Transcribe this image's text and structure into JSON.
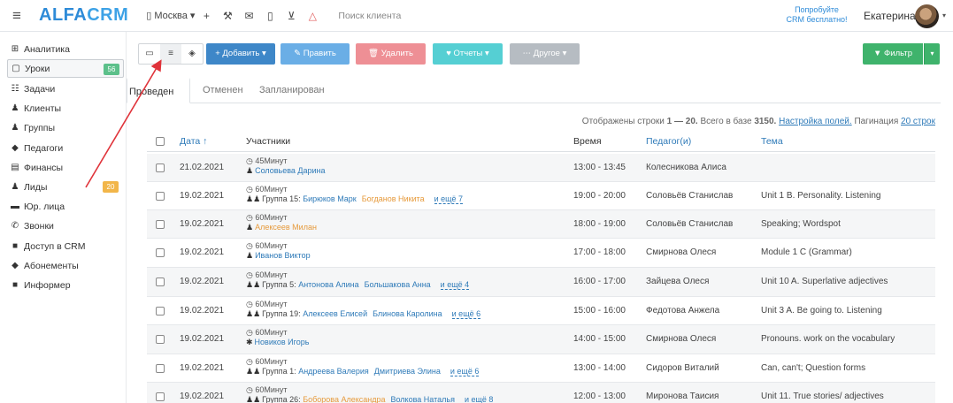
{
  "header": {
    "logo_part1": "ALFA",
    "logo_part2": "CRM",
    "city": "Москва",
    "search_placeholder": "Поиск клиента",
    "try_line1": "Попробуйте",
    "try_line2": "CRM бесплатно!",
    "user_name": "Екатерина"
  },
  "sidebar": {
    "items": [
      {
        "label": "Аналитика",
        "icon": "chart-icon"
      },
      {
        "label": "Уроки",
        "icon": "calendar-icon",
        "badge": "56"
      },
      {
        "label": "Задачи",
        "icon": "tasks-icon"
      },
      {
        "label": "Клиенты",
        "icon": "user-icon"
      },
      {
        "label": "Группы",
        "icon": "users-icon"
      },
      {
        "label": "Педагоги",
        "icon": "graduation-cap-icon"
      },
      {
        "label": "Финансы",
        "icon": "money-icon"
      },
      {
        "label": "Лиды",
        "icon": "user-plus-icon",
        "badge": "20"
      },
      {
        "label": "Юр. лица",
        "icon": "briefcase-icon"
      },
      {
        "label": "Звонки",
        "icon": "phone-icon"
      },
      {
        "label": "Доступ в CRM",
        "icon": "lock-icon"
      },
      {
        "label": "Абонементы",
        "icon": "tag-icon"
      },
      {
        "label": "Информер",
        "icon": "news-icon"
      }
    ]
  },
  "toolbar": {
    "add": "+ Добавить ▾",
    "edit": "✎ Править",
    "delete": "🗑 Удалить",
    "reports": "♥ Отчеты ▾",
    "other": "⋯ Другое ▾",
    "filter": "▼ Фильтр"
  },
  "tabs": [
    "Проведен",
    "Отменен",
    "Запланирован"
  ],
  "info": {
    "prefix": "Отображены строки ",
    "range": "1 — 20.",
    "total_prefix": " Всего в базе ",
    "total": "3150.",
    "fields_link": "Настройка полей.",
    "pagination_prefix": " Пагинация ",
    "pagination_link": "20 строк"
  },
  "table": {
    "columns": {
      "date": "Дата ↑",
      "participants": "Участники",
      "time": "Время",
      "teacher": "Педагог(и)",
      "topic": "Тема"
    },
    "rows": [
      {
        "date": "21.02.2021",
        "duration": "◷ 45Минут",
        "prefix": "",
        "people": [
          {
            "name": "Соловьева Дарина",
            "color": "blue"
          }
        ],
        "more": "",
        "time": "13:00 - 13:45",
        "teacher": "Колесникова Алиса",
        "topic": ""
      },
      {
        "date": "19.02.2021",
        "duration": "◷ 60Минут",
        "prefix": "Группа 15: ",
        "people": [
          {
            "name": "Бирюков Марк",
            "color": "blue"
          },
          {
            "name": "Богданов Никита",
            "color": "orange"
          }
        ],
        "more": "и ещё 7",
        "time": "19:00 - 20:00",
        "teacher": "Соловьёв Станислав",
        "topic": "Unit 1 B. Personality. Listening"
      },
      {
        "date": "19.02.2021",
        "duration": "◷ 60Минут",
        "prefix": "",
        "people": [
          {
            "name": "Алексеев Милан",
            "color": "orange"
          }
        ],
        "more": "",
        "time": "18:00 - 19:00",
        "teacher": "Соловьёв Станислав",
        "topic": "Speaking; Wordspot"
      },
      {
        "date": "19.02.2021",
        "duration": "◷ 60Минут",
        "prefix": "",
        "people": [
          {
            "name": "Иванов Виктор",
            "color": "blue"
          }
        ],
        "more": "",
        "time": "17:00 - 18:00",
        "teacher": "Смирнова Олеся",
        "topic": "Module 1 C (Grammar)"
      },
      {
        "date": "19.02.2021",
        "duration": "◷ 60Минут",
        "prefix": "Группа 5: ",
        "people": [
          {
            "name": "Антонова Алина",
            "color": "blue"
          },
          {
            "name": "Большакова Анна",
            "color": "blue"
          }
        ],
        "more": "и ещё 4",
        "time": "16:00 - 17:00",
        "teacher": "Зайцева Олеся",
        "topic": "Unit 10 A. Superlative adjectives"
      },
      {
        "date": "19.02.2021",
        "duration": "◷ 60Минут",
        "prefix": "Группа 19: ",
        "people": [
          {
            "name": "Алексеев Елисей",
            "color": "blue"
          },
          {
            "name": "Блинова Каролина",
            "color": "blue"
          }
        ],
        "more": "и ещё 6",
        "time": "15:00 - 16:00",
        "teacher": "Федотова Анжела",
        "topic": "Unit 3 A. Be going to. Listening"
      },
      {
        "date": "19.02.2021",
        "duration": "◷ 60Минут",
        "prefix": "",
        "people": [
          {
            "name": "Новиков Игорь",
            "color": "blue"
          }
        ],
        "more": "",
        "time": "14:00 - 15:00",
        "teacher": "Смирнова Олеся",
        "topic": "Pronouns. work on the vocabulary",
        "icon": "star"
      },
      {
        "date": "19.02.2021",
        "duration": "◷ 60Минут",
        "prefix": "Группа 1: ",
        "people": [
          {
            "name": "Андреева Валерия",
            "color": "blue"
          },
          {
            "name": "Дмитриева Элина",
            "color": "blue"
          }
        ],
        "more": "и ещё 6",
        "time": "13:00 - 14:00",
        "teacher": "Сидоров Виталий",
        "topic": "Can, can't; Question forms"
      },
      {
        "date": "19.02.2021",
        "duration": "◷ 60Минут",
        "prefix": "Группа 26: ",
        "people": [
          {
            "name": "Боборова Александра",
            "color": "orange"
          },
          {
            "name": "Волкова Наталья",
            "color": "blue"
          }
        ],
        "more": "и ещё 8",
        "time": "12:00 - 13:00",
        "teacher": "Миронова Таисия",
        "topic": "Unit 11. True stories/ adjectives"
      }
    ]
  },
  "colors": {
    "accent": "#2e8bd8",
    "add_button": "#3e87c8",
    "delete_button": "#ee8f95",
    "filter_button": "#3fb36c",
    "arrow": "#e0333a"
  }
}
